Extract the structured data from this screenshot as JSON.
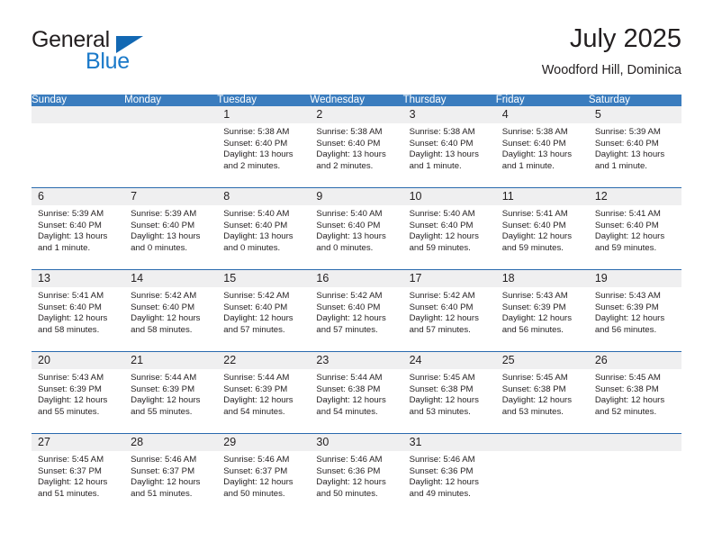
{
  "brand": {
    "name_part1": "General",
    "name_part2": "Blue",
    "triangle_color": "#1268b3",
    "blue_color": "#1a79c9"
  },
  "header": {
    "month_title": "July 2025",
    "location": "Woodford Hill, Dominica"
  },
  "theme": {
    "header_row_bg": "#3a7cbe",
    "header_row_text": "#ffffff",
    "cell_border": "#2a6aae",
    "daynum_bg": "#efeff0",
    "text": "#231f20"
  },
  "weekday_headers": [
    "Sunday",
    "Monday",
    "Tuesday",
    "Wednesday",
    "Thursday",
    "Friday",
    "Saturday"
  ],
  "weeks": [
    [
      {
        "day": "",
        "sunrise": "",
        "sunset": "",
        "daylight": "",
        "empty": true
      },
      {
        "day": "",
        "sunrise": "",
        "sunset": "",
        "daylight": "",
        "empty": true
      },
      {
        "day": "1",
        "sunrise": "Sunrise: 5:38 AM",
        "sunset": "Sunset: 6:40 PM",
        "daylight": "Daylight: 13 hours and 2 minutes."
      },
      {
        "day": "2",
        "sunrise": "Sunrise: 5:38 AM",
        "sunset": "Sunset: 6:40 PM",
        "daylight": "Daylight: 13 hours and 2 minutes."
      },
      {
        "day": "3",
        "sunrise": "Sunrise: 5:38 AM",
        "sunset": "Sunset: 6:40 PM",
        "daylight": "Daylight: 13 hours and 1 minute."
      },
      {
        "day": "4",
        "sunrise": "Sunrise: 5:38 AM",
        "sunset": "Sunset: 6:40 PM",
        "daylight": "Daylight: 13 hours and 1 minute."
      },
      {
        "day": "5",
        "sunrise": "Sunrise: 5:39 AM",
        "sunset": "Sunset: 6:40 PM",
        "daylight": "Daylight: 13 hours and 1 minute."
      }
    ],
    [
      {
        "day": "6",
        "sunrise": "Sunrise: 5:39 AM",
        "sunset": "Sunset: 6:40 PM",
        "daylight": "Daylight: 13 hours and 1 minute."
      },
      {
        "day": "7",
        "sunrise": "Sunrise: 5:39 AM",
        "sunset": "Sunset: 6:40 PM",
        "daylight": "Daylight: 13 hours and 0 minutes."
      },
      {
        "day": "8",
        "sunrise": "Sunrise: 5:40 AM",
        "sunset": "Sunset: 6:40 PM",
        "daylight": "Daylight: 13 hours and 0 minutes."
      },
      {
        "day": "9",
        "sunrise": "Sunrise: 5:40 AM",
        "sunset": "Sunset: 6:40 PM",
        "daylight": "Daylight: 13 hours and 0 minutes."
      },
      {
        "day": "10",
        "sunrise": "Sunrise: 5:40 AM",
        "sunset": "Sunset: 6:40 PM",
        "daylight": "Daylight: 12 hours and 59 minutes."
      },
      {
        "day": "11",
        "sunrise": "Sunrise: 5:41 AM",
        "sunset": "Sunset: 6:40 PM",
        "daylight": "Daylight: 12 hours and 59 minutes."
      },
      {
        "day": "12",
        "sunrise": "Sunrise: 5:41 AM",
        "sunset": "Sunset: 6:40 PM",
        "daylight": "Daylight: 12 hours and 59 minutes."
      }
    ],
    [
      {
        "day": "13",
        "sunrise": "Sunrise: 5:41 AM",
        "sunset": "Sunset: 6:40 PM",
        "daylight": "Daylight: 12 hours and 58 minutes."
      },
      {
        "day": "14",
        "sunrise": "Sunrise: 5:42 AM",
        "sunset": "Sunset: 6:40 PM",
        "daylight": "Daylight: 12 hours and 58 minutes."
      },
      {
        "day": "15",
        "sunrise": "Sunrise: 5:42 AM",
        "sunset": "Sunset: 6:40 PM",
        "daylight": "Daylight: 12 hours and 57 minutes."
      },
      {
        "day": "16",
        "sunrise": "Sunrise: 5:42 AM",
        "sunset": "Sunset: 6:40 PM",
        "daylight": "Daylight: 12 hours and 57 minutes."
      },
      {
        "day": "17",
        "sunrise": "Sunrise: 5:42 AM",
        "sunset": "Sunset: 6:40 PM",
        "daylight": "Daylight: 12 hours and 57 minutes."
      },
      {
        "day": "18",
        "sunrise": "Sunrise: 5:43 AM",
        "sunset": "Sunset: 6:39 PM",
        "daylight": "Daylight: 12 hours and 56 minutes."
      },
      {
        "day": "19",
        "sunrise": "Sunrise: 5:43 AM",
        "sunset": "Sunset: 6:39 PM",
        "daylight": "Daylight: 12 hours and 56 minutes."
      }
    ],
    [
      {
        "day": "20",
        "sunrise": "Sunrise: 5:43 AM",
        "sunset": "Sunset: 6:39 PM",
        "daylight": "Daylight: 12 hours and 55 minutes."
      },
      {
        "day": "21",
        "sunrise": "Sunrise: 5:44 AM",
        "sunset": "Sunset: 6:39 PM",
        "daylight": "Daylight: 12 hours and 55 minutes."
      },
      {
        "day": "22",
        "sunrise": "Sunrise: 5:44 AM",
        "sunset": "Sunset: 6:39 PM",
        "daylight": "Daylight: 12 hours and 54 minutes."
      },
      {
        "day": "23",
        "sunrise": "Sunrise: 5:44 AM",
        "sunset": "Sunset: 6:38 PM",
        "daylight": "Daylight: 12 hours and 54 minutes."
      },
      {
        "day": "24",
        "sunrise": "Sunrise: 5:45 AM",
        "sunset": "Sunset: 6:38 PM",
        "daylight": "Daylight: 12 hours and 53 minutes."
      },
      {
        "day": "25",
        "sunrise": "Sunrise: 5:45 AM",
        "sunset": "Sunset: 6:38 PM",
        "daylight": "Daylight: 12 hours and 53 minutes."
      },
      {
        "day": "26",
        "sunrise": "Sunrise: 5:45 AM",
        "sunset": "Sunset: 6:38 PM",
        "daylight": "Daylight: 12 hours and 52 minutes."
      }
    ],
    [
      {
        "day": "27",
        "sunrise": "Sunrise: 5:45 AM",
        "sunset": "Sunset: 6:37 PM",
        "daylight": "Daylight: 12 hours and 51 minutes."
      },
      {
        "day": "28",
        "sunrise": "Sunrise: 5:46 AM",
        "sunset": "Sunset: 6:37 PM",
        "daylight": "Daylight: 12 hours and 51 minutes."
      },
      {
        "day": "29",
        "sunrise": "Sunrise: 5:46 AM",
        "sunset": "Sunset: 6:37 PM",
        "daylight": "Daylight: 12 hours and 50 minutes."
      },
      {
        "day": "30",
        "sunrise": "Sunrise: 5:46 AM",
        "sunset": "Sunset: 6:36 PM",
        "daylight": "Daylight: 12 hours and 50 minutes."
      },
      {
        "day": "31",
        "sunrise": "Sunrise: 5:46 AM",
        "sunset": "Sunset: 6:36 PM",
        "daylight": "Daylight: 12 hours and 49 minutes."
      },
      {
        "day": "",
        "sunrise": "",
        "sunset": "",
        "daylight": "",
        "empty": true
      },
      {
        "day": "",
        "sunrise": "",
        "sunset": "",
        "daylight": "",
        "empty": true
      }
    ]
  ]
}
